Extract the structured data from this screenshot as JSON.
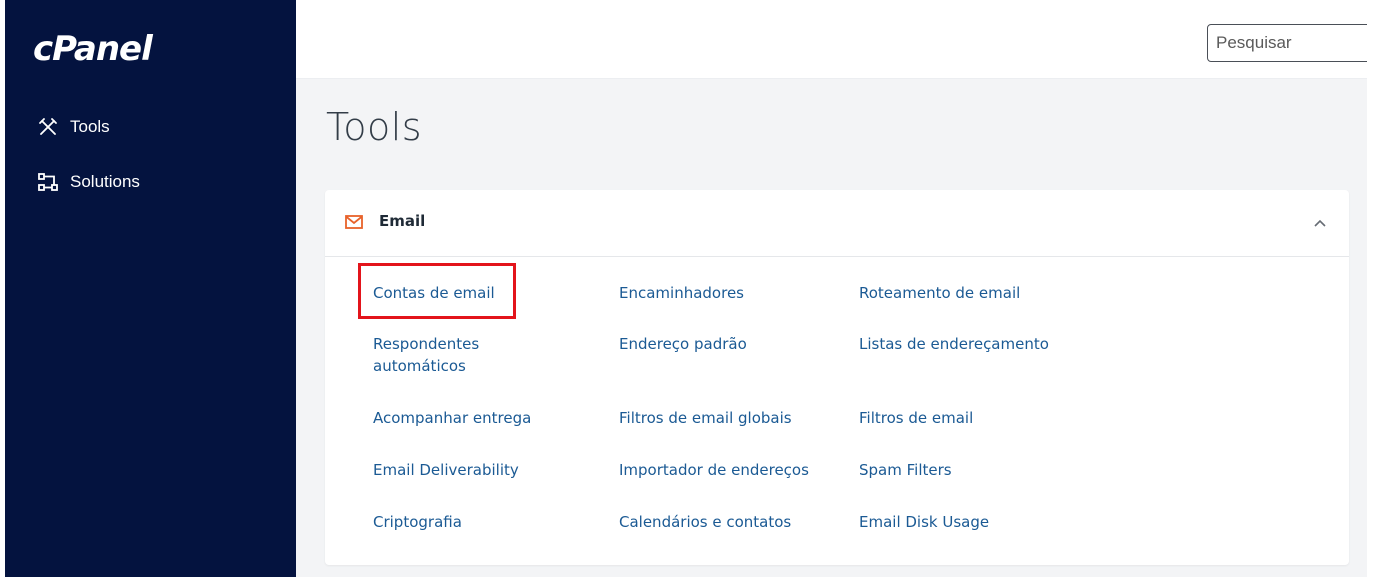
{
  "sidebar": {
    "logo_text": "cPanel",
    "items": [
      {
        "label": "Tools",
        "icon": "tools-icon"
      },
      {
        "label": "Solutions",
        "icon": "solutions-icon"
      }
    ]
  },
  "header": {
    "search": {
      "placeholder": "Pesquisar",
      "value": ""
    }
  },
  "main": {
    "page_title": "Tools",
    "email_section": {
      "title": "Email",
      "icon": "mail-icon",
      "accent_color": "#e8622a",
      "expanded": true,
      "links": [
        [
          "Contas de email",
          "Encaminhadores",
          "Roteamento de email"
        ],
        [
          "Respondentes automáticos",
          "Endereço padrão",
          "Listas de endereçamento"
        ],
        [
          "Acompanhar entrega",
          "Filtros de email globais",
          "Filtros de email"
        ],
        [
          "Email Deliverability",
          "Importador de endereços",
          "Spam Filters"
        ],
        [
          "Criptografia",
          "Calendários e contatos",
          "Email Disk Usage"
        ]
      ],
      "highlighted_link": "Contas de email",
      "highlight_color": "#e3141b",
      "link_color": "#1b5a94"
    }
  }
}
